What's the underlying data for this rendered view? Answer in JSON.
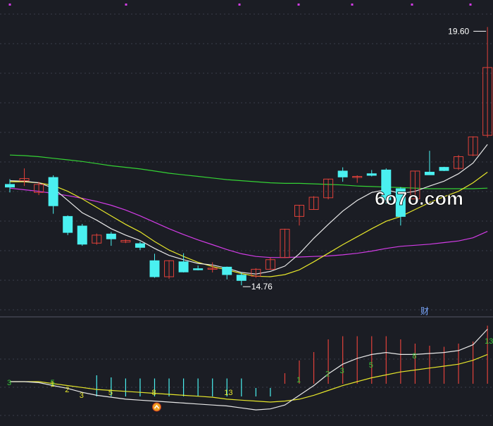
{
  "colors": {
    "background": "#1b1d24",
    "grid": "#3a3d4a",
    "up": "#e0413a",
    "down": "#4af0f0",
    "ma_white": "#e8e8e8",
    "ma_yellow": "#e6e62a",
    "ma_magenta": "#d23ce6",
    "ma_green": "#34d234",
    "seq_green": "#38c838",
    "seq_yellow": "#e6e62a"
  },
  "watermark": "6o7o.com",
  "chart_data": [
    {
      "type": "candlestick",
      "title": "",
      "max_label": "19.60",
      "min_label": "14.76",
      "marker_label": "财",
      "ylim": [
        14.3,
        20.0
      ],
      "candles": [
        {
          "o": 16.65,
          "h": 16.75,
          "l": 16.5,
          "c": 16.6
        },
        {
          "o": 16.72,
          "h": 16.95,
          "l": 16.62,
          "c": 16.76
        },
        {
          "o": 16.5,
          "h": 16.7,
          "l": 16.45,
          "c": 16.65
        },
        {
          "o": 16.78,
          "h": 16.82,
          "l": 16.1,
          "c": 16.25
        },
        {
          "o": 16.05,
          "h": 16.07,
          "l": 15.7,
          "c": 15.75
        },
        {
          "o": 15.87,
          "h": 15.91,
          "l": 15.5,
          "c": 15.53
        },
        {
          "o": 15.55,
          "h": 15.73,
          "l": 15.52,
          "c": 15.7
        },
        {
          "o": 15.72,
          "h": 15.76,
          "l": 15.5,
          "c": 15.63
        },
        {
          "o": 15.57,
          "h": 15.62,
          "l": 15.55,
          "c": 15.6
        },
        {
          "o": 15.54,
          "h": 15.58,
          "l": 15.42,
          "c": 15.47
        },
        {
          "o": 15.22,
          "h": 15.35,
          "l": 14.9,
          "c": 14.92
        },
        {
          "o": 14.92,
          "h": 15.23,
          "l": 14.88,
          "c": 15.22
        },
        {
          "o": 15.2,
          "h": 15.36,
          "l": 15.0,
          "c": 15.01
        },
        {
          "o": 15.07,
          "h": 15.13,
          "l": 15.04,
          "c": 15.05
        },
        {
          "o": 15.08,
          "h": 15.19,
          "l": 15.0,
          "c": 15.08
        },
        {
          "o": 15.1,
          "h": 15.11,
          "l": 14.87,
          "c": 14.96
        },
        {
          "o": 14.95,
          "h": 15.0,
          "l": 14.76,
          "c": 14.85
        },
        {
          "o": 14.93,
          "h": 15.08,
          "l": 14.9,
          "c": 15.06
        },
        {
          "o": 15.06,
          "h": 15.28,
          "l": 15.06,
          "c": 15.24
        },
        {
          "o": 15.28,
          "h": 15.82,
          "l": 15.27,
          "c": 15.81
        },
        {
          "o": 16.05,
          "h": 16.26,
          "l": 15.88,
          "c": 16.26
        },
        {
          "o": 16.18,
          "h": 16.43,
          "l": 16.18,
          "c": 16.41
        },
        {
          "o": 16.4,
          "h": 16.75,
          "l": 16.37,
          "c": 16.75
        },
        {
          "o": 16.9,
          "h": 16.97,
          "l": 16.7,
          "c": 16.79
        },
        {
          "o": 16.8,
          "h": 16.82,
          "l": 16.68,
          "c": 16.8
        },
        {
          "o": 16.85,
          "h": 16.92,
          "l": 16.8,
          "c": 16.82
        },
        {
          "o": 16.92,
          "h": 16.95,
          "l": 16.29,
          "c": 16.36
        },
        {
          "o": 16.57,
          "h": 16.6,
          "l": 15.88,
          "c": 16.05
        },
        {
          "o": 16.38,
          "h": 16.9,
          "l": 16.38,
          "c": 16.9
        },
        {
          "o": 16.88,
          "h": 17.28,
          "l": 16.84,
          "c": 16.83
        },
        {
          "o": 16.97,
          "h": 16.98,
          "l": 16.9,
          "c": 16.91
        },
        {
          "o": 16.95,
          "h": 17.2,
          "l": 16.92,
          "c": 17.17
        },
        {
          "o": 17.2,
          "h": 17.55,
          "l": 17.18,
          "c": 17.54
        },
        {
          "o": 17.57,
          "h": 19.6,
          "l": 17.53,
          "c": 18.84
        }
      ],
      "ma_white": [
        16.72,
        16.71,
        16.68,
        16.58,
        16.35,
        16.12,
        15.98,
        15.82,
        15.7,
        15.6,
        15.45,
        15.32,
        15.24,
        15.17,
        15.14,
        15.08,
        15.0,
        14.97,
        15.02,
        15.12,
        15.35,
        15.64,
        15.9,
        16.15,
        16.35,
        16.5,
        16.55,
        16.48,
        16.52,
        16.62,
        16.71,
        16.85,
        17.05,
        17.4
      ],
      "ma_yellow": [
        16.7,
        16.7,
        16.68,
        16.63,
        16.52,
        16.38,
        16.22,
        16.06,
        15.9,
        15.76,
        15.58,
        15.42,
        15.3,
        15.19,
        15.11,
        15.05,
        14.98,
        14.93,
        14.92,
        14.96,
        15.05,
        15.2,
        15.36,
        15.52,
        15.67,
        15.82,
        15.96,
        16.05,
        16.18,
        16.31,
        16.42,
        16.52,
        16.68,
        16.88
      ],
      "ma_magenta": [
        16.58,
        16.55,
        16.52,
        16.48,
        16.44,
        16.39,
        16.33,
        16.26,
        16.17,
        16.06,
        15.94,
        15.82,
        15.71,
        15.61,
        15.52,
        15.43,
        15.35,
        15.3,
        15.28,
        15.28,
        15.29,
        15.3,
        15.31,
        15.33,
        15.36,
        15.4,
        15.45,
        15.49,
        15.51,
        15.53,
        15.56,
        15.59,
        15.65,
        15.77
      ],
      "ma_green": [
        17.2,
        17.19,
        17.17,
        17.14,
        17.11,
        17.08,
        17.04,
        17.0,
        16.97,
        16.94,
        16.9,
        16.86,
        16.83,
        16.8,
        16.77,
        16.74,
        16.72,
        16.7,
        16.68,
        16.67,
        16.67,
        16.66,
        16.65,
        16.64,
        16.62,
        16.61,
        16.6,
        16.59,
        16.58,
        16.57,
        16.57,
        16.57,
        16.57,
        16.58
      ]
    },
    {
      "type": "indicator",
      "title": "",
      "ylim": [
        0,
        100
      ],
      "bars": [
        0,
        0,
        0,
        0,
        0,
        0,
        0,
        0,
        0,
        0,
        0,
        0,
        0,
        0,
        0,
        0,
        0,
        0,
        0,
        0,
        0,
        0,
        0,
        0,
        0,
        0,
        0,
        0,
        0,
        0,
        0,
        0,
        0,
        0
      ],
      "bar_levels": [
        0,
        0,
        0,
        0,
        0,
        0,
        20,
        18,
        17,
        17,
        17,
        17,
        17,
        17,
        17,
        17,
        17,
        8,
        8,
        10,
        22,
        30,
        42,
        45,
        45,
        45,
        45,
        42,
        38,
        36,
        35,
        38,
        40,
        55
      ],
      "bar_up": [
        false,
        false,
        false,
        false,
        false,
        false,
        false,
        false,
        false,
        false,
        false,
        false,
        false,
        false,
        false,
        false,
        false,
        false,
        false,
        true,
        true,
        true,
        true,
        true,
        true,
        true,
        true,
        true,
        true,
        true,
        true,
        true,
        true,
        true
      ],
      "white_line": [
        42,
        42,
        41,
        38,
        35,
        31,
        28,
        26,
        24,
        23,
        22,
        21,
        20,
        19,
        18,
        17,
        15,
        13,
        14,
        18,
        28,
        38,
        50,
        60,
        66,
        70,
        72,
        70,
        70,
        71,
        72,
        74,
        80,
        96
      ],
      "yellow_line": [
        42,
        42,
        42,
        40,
        38,
        36,
        34,
        33,
        32,
        31,
        30,
        29,
        28,
        27,
        26,
        24,
        23,
        22,
        21,
        22,
        24,
        28,
        33,
        38,
        42,
        46,
        49,
        52,
        54,
        56,
        58,
        60,
        64,
        70
      ],
      "counts_green": [
        {
          "label": "3",
          "col": -1
        },
        {
          "label": "5",
          "col": 2
        },
        {
          "label": "1",
          "col": 19
        },
        {
          "label": "2",
          "col": 21
        },
        {
          "label": "3",
          "col": 22
        },
        {
          "label": "5",
          "col": 24
        },
        {
          "label": "8",
          "col": 27
        },
        {
          "label": "13",
          "col": 32
        }
      ],
      "counts_yellow": [
        {
          "label": "1",
          "col": 3
        },
        {
          "label": "2",
          "col": 4
        },
        {
          "label": "3",
          "col": 5
        },
        {
          "label": "5",
          "col": 7
        },
        {
          "label": "8",
          "col": 10
        },
        {
          "label": "13",
          "col": 15
        }
      ],
      "signal_col": 10
    }
  ]
}
